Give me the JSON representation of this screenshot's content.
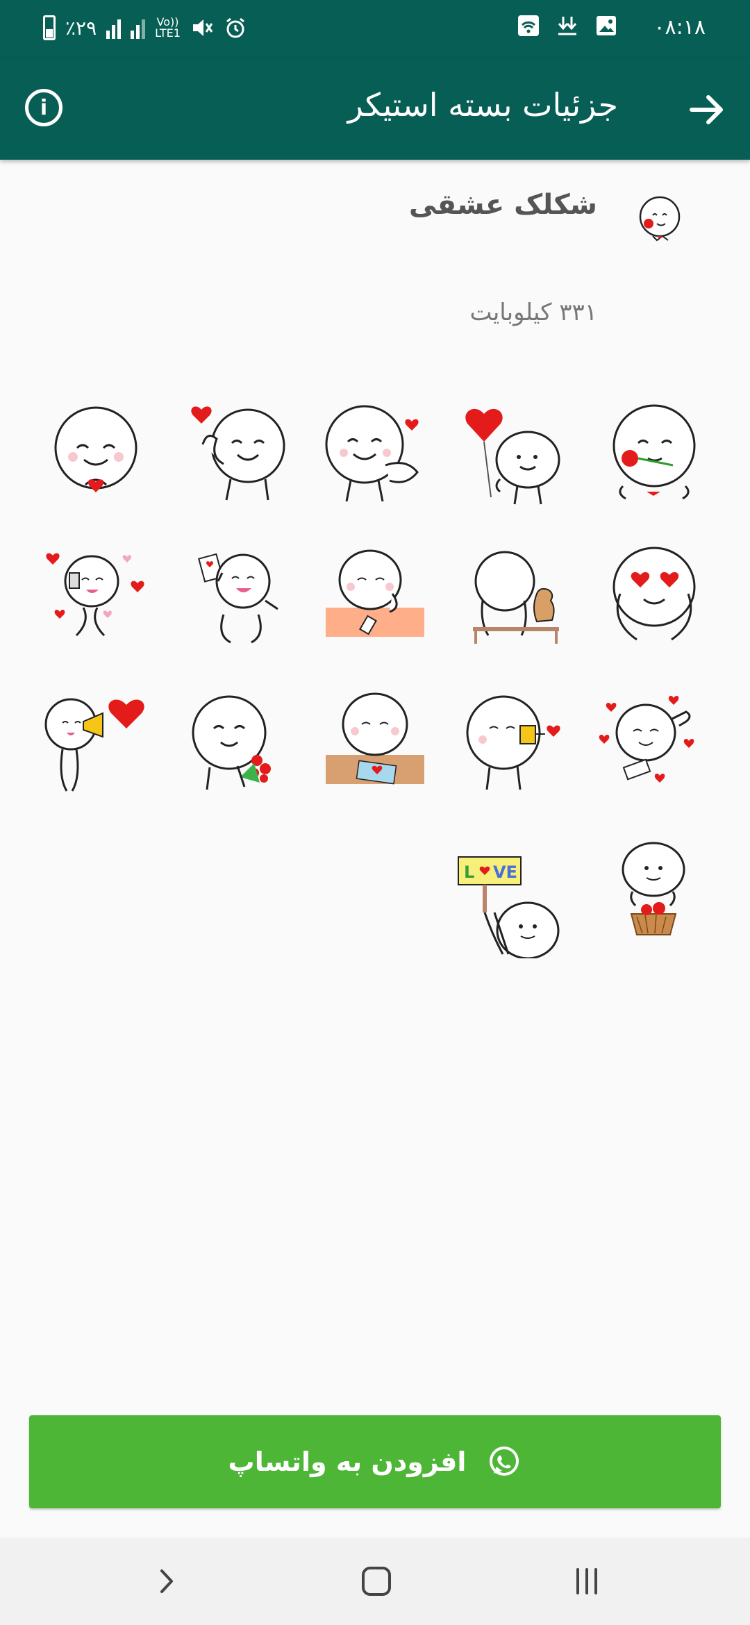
{
  "status_bar": {
    "time": "۰۸:۱۸",
    "battery_text": "٪۲۹",
    "network_label": "Vo))\nLTE1"
  },
  "app_bar": {
    "title": "جزئیات بسته استیکر",
    "back_icon": "arrow-forward-icon",
    "info_icon": "info-icon",
    "info_glyph": "i"
  },
  "pack": {
    "name": "شکلک عشقی",
    "size": "۳۳۱ کیلوبایت",
    "icon": "sticker-rose-face"
  },
  "stickers": [
    {
      "name": "rose-kiss",
      "row": 0
    },
    {
      "name": "balloon-heart",
      "row": 0
    },
    {
      "name": "finger-heart",
      "row": 0
    },
    {
      "name": "waving-heart",
      "row": 0
    },
    {
      "name": "heart-hands",
      "row": 0
    },
    {
      "name": "heart-eyes",
      "row": 1
    },
    {
      "name": "dog-bench",
      "row": 1
    },
    {
      "name": "desk-phone",
      "row": 1
    },
    {
      "name": "selfie-dance",
      "row": 1
    },
    {
      "name": "selfie-hearts",
      "row": 1
    },
    {
      "name": "lying-hearts",
      "row": 2
    },
    {
      "name": "cup-phone-heart",
      "row": 2
    },
    {
      "name": "writing-letter",
      "row": 2
    },
    {
      "name": "flower-bouquet",
      "row": 2
    },
    {
      "name": "megaphone-heart",
      "row": 2
    },
    {
      "name": "heart-basket",
      "row": 3
    },
    {
      "name": "love-sign",
      "row": 3
    }
  ],
  "add_button": {
    "label": "افزودن به واتساپ",
    "icon": "whatsapp-icon"
  },
  "nav_bar": {
    "back_icon": "chevron-back-icon",
    "home_icon": "home-square-icon",
    "recents_icon": "recents-lines-icon"
  },
  "colors": {
    "header": "#075e54",
    "button": "#4db636"
  }
}
